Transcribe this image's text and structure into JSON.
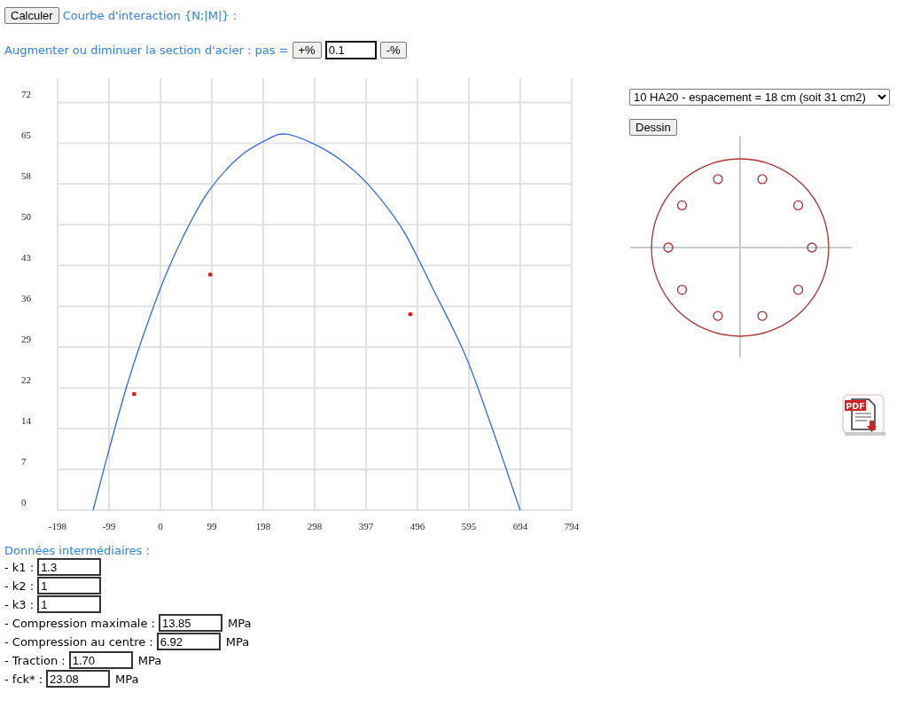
{
  "toolbar": {
    "calc_button": "Calculer",
    "curve_label": "Courbe d'interaction {N;|M|} :"
  },
  "steel_step": {
    "label": "Augmenter ou diminuer la section d'acier : pas =",
    "plus_button": "+%",
    "value": "0.1",
    "minus_button": "-%"
  },
  "chart": {
    "chart_data": {
      "type": "line",
      "grid": true,
      "xlim": [
        -198.4,
        793.6
      ],
      "ylim": [
        0,
        76.3
      ],
      "xticks": [
        {
          "value": -198.4,
          "label": "-198"
        },
        {
          "value": -99.2,
          "label": "-99"
        },
        {
          "value": 0,
          "label": "0"
        },
        {
          "value": 99.2,
          "label": "99"
        },
        {
          "value": 198.4,
          "label": "198"
        },
        {
          "value": 297.6,
          "label": "298"
        },
        {
          "value": 396.8,
          "label": "397"
        },
        {
          "value": 496,
          "label": "496"
        },
        {
          "value": 595.2,
          "label": "595"
        },
        {
          "value": 694.4,
          "label": "694"
        },
        {
          "value": 793.6,
          "label": "794"
        }
      ],
      "yticks": [
        {
          "value": 0,
          "label": "0"
        },
        {
          "value": 7.2,
          "label": "7"
        },
        {
          "value": 14.4,
          "label": "14"
        },
        {
          "value": 21.6,
          "label": "22"
        },
        {
          "value": 28.8,
          "label": "29"
        },
        {
          "value": 36,
          "label": "36"
        },
        {
          "value": 43.2,
          "label": "43"
        },
        {
          "value": 50.4,
          "label": "50"
        },
        {
          "value": 57.6,
          "label": "58"
        },
        {
          "value": 64.8,
          "label": "65"
        },
        {
          "value": 72,
          "label": "72"
        }
      ],
      "series": [
        {
          "type": "line",
          "color": "#3366ee",
          "x": [
            -130,
            -65,
            -2,
            45,
            92,
            150,
            203,
            243,
            306,
            360,
            409,
            469,
            528,
            588,
            640,
            694
          ],
          "values": [
            0,
            21.9,
            38.7,
            48.5,
            56.2,
            62.2,
            65.3,
            66.4,
            64.2,
            61,
            56.7,
            49.3,
            38.7,
            27.4,
            14.5,
            0
          ]
        },
        {
          "type": "scatter",
          "color": "#ff0000",
          "x": [
            -51,
            96,
            482
          ],
          "values": [
            20.5,
            41.6,
            34.6
          ]
        }
      ]
    }
  },
  "section": {
    "bar_option": "10 HA20 - espacement = 18 cm (soit 31 cm2)",
    "draw_button": "Dessin",
    "pdf_icon_label": "PDF"
  },
  "intermediate": {
    "title": "Données intermédiaires :",
    "rows": [
      {
        "label": "- k1 :",
        "value": "1.3"
      },
      {
        "label": "- k2 :",
        "value": "1"
      },
      {
        "label": "- k3 :",
        "value": "1"
      },
      {
        "label": "- Compression maximale :",
        "value": "13.85",
        "unit": "MPa"
      },
      {
        "label": "- Compression au centre :",
        "value": "6.92",
        "unit": "MPa"
      },
      {
        "label": "- Traction :",
        "value": "1.70",
        "unit": "MPa"
      },
      {
        "label": "- fck* :",
        "value": "23.08",
        "unit": "MPa"
      }
    ]
  }
}
